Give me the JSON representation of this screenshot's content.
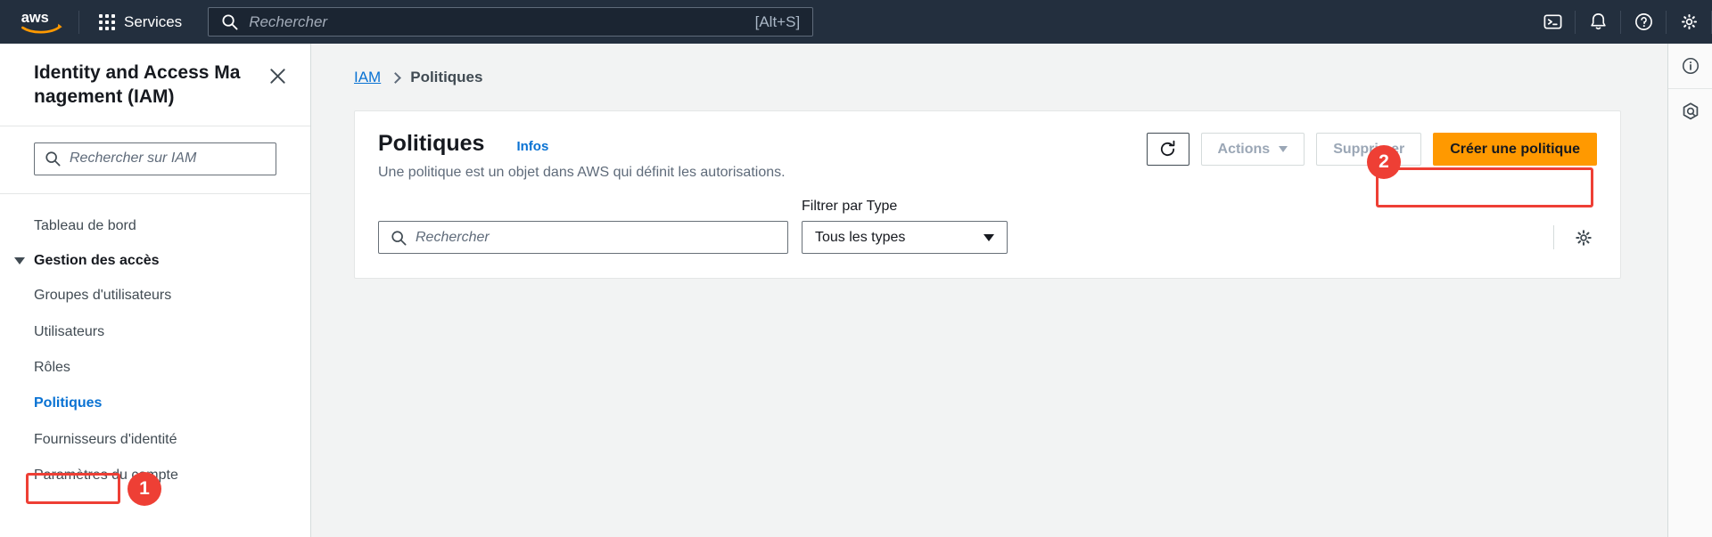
{
  "topnav": {
    "logo_alt": "aws",
    "services_label": "Services",
    "search": {
      "placeholder": "Rechercher",
      "shortcut": "[Alt+S]",
      "value": ""
    },
    "icons": [
      {
        "name": "cloudshell-icon"
      },
      {
        "name": "notifications-bell-icon"
      },
      {
        "name": "help-question-icon"
      },
      {
        "name": "settings-gear-icon"
      }
    ]
  },
  "sidebar": {
    "title": "Identity and Access Management (IAM)",
    "close_label": "×",
    "search": {
      "placeholder": "Rechercher sur IAM",
      "value": ""
    },
    "dashboard_label": "Tableau de bord",
    "group_label": "Gestion des accès",
    "items": [
      {
        "label": "Groupes d'utilisateurs"
      },
      {
        "label": "Utilisateurs"
      },
      {
        "label": "Rôles"
      },
      {
        "label": "Politiques"
      },
      {
        "label": "Fournisseurs d'identité"
      },
      {
        "label": "Paramètres du compte"
      }
    ]
  },
  "annotations": [
    {
      "badge": "1",
      "target": "sidebar-politiques"
    },
    {
      "badge": "2",
      "target": "create-policy-button"
    }
  ],
  "breadcrumb": {
    "root": "IAM",
    "current": "Politiques"
  },
  "panel": {
    "title": "Politiques",
    "info_link": "Infos",
    "subtitle": "Une politique est un objet dans AWS qui définit les autorisations.",
    "refresh_label": "",
    "actions_label": "Actions",
    "delete_label": "Supprimer",
    "create_label": "Créer une politique",
    "search": {
      "placeholder": "Rechercher",
      "value": ""
    },
    "filter_label": "Filtrer par Type",
    "filter_value": "Tous les types"
  },
  "rightrail": {
    "items": [
      {
        "name": "info-circle-icon"
      },
      {
        "name": "amazon-q-hex-icon"
      }
    ]
  },
  "colors": {
    "nav_bg": "#232f3e",
    "accent_orange": "#ff9900",
    "link_blue": "#0972d3",
    "annotation_red": "#ee3f35",
    "page_bg": "#f2f3f3"
  }
}
